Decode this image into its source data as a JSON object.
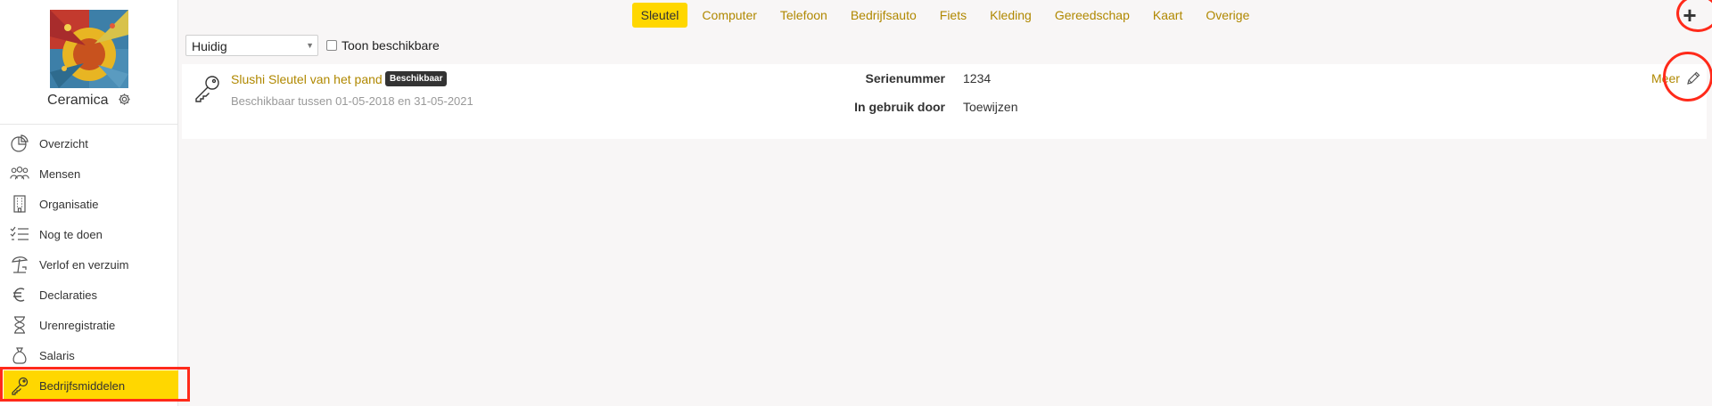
{
  "org": {
    "name": "Ceramica"
  },
  "nav": {
    "items": [
      {
        "label": "Overzicht",
        "icon": "pie-chart-icon"
      },
      {
        "label": "Mensen",
        "icon": "people-icon"
      },
      {
        "label": "Organisatie",
        "icon": "building-icon"
      },
      {
        "label": "Nog te doen",
        "icon": "checklist-icon"
      },
      {
        "label": "Verlof en verzuim",
        "icon": "beach-umbrella-icon"
      },
      {
        "label": "Declaraties",
        "icon": "euro-icon"
      },
      {
        "label": "Urenregistratie",
        "icon": "hourglass-icon"
      },
      {
        "label": "Salaris",
        "icon": "money-bag-icon"
      },
      {
        "label": "Bedrijfsmiddelen",
        "icon": "key-icon",
        "active": true
      }
    ]
  },
  "tabs": [
    "Sleutel",
    "Computer",
    "Telefoon",
    "Bedrijfsauto",
    "Fiets",
    "Kleding",
    "Gereedschap",
    "Kaart",
    "Overige"
  ],
  "active_tab": "Sleutel",
  "toolbar": {
    "add_label": "+"
  },
  "filter": {
    "selected": "Huidig",
    "checkbox_label": "Toon beschikbare",
    "checkbox_checked": false
  },
  "item": {
    "title": "Slushi Sleutel van het pand",
    "badge": "Beschikbaar",
    "subtitle": "Beschikbaar tussen 01-05-2018 en 31-05-2021",
    "details": [
      {
        "label": "Serienummer",
        "value": "1234"
      },
      {
        "label": "In gebruik door",
        "value": "Toewijzen"
      }
    ],
    "more_label": "Meer"
  },
  "colors": {
    "accent": "#ffd700",
    "link": "#b08800",
    "annotation": "#ff2a1a"
  }
}
